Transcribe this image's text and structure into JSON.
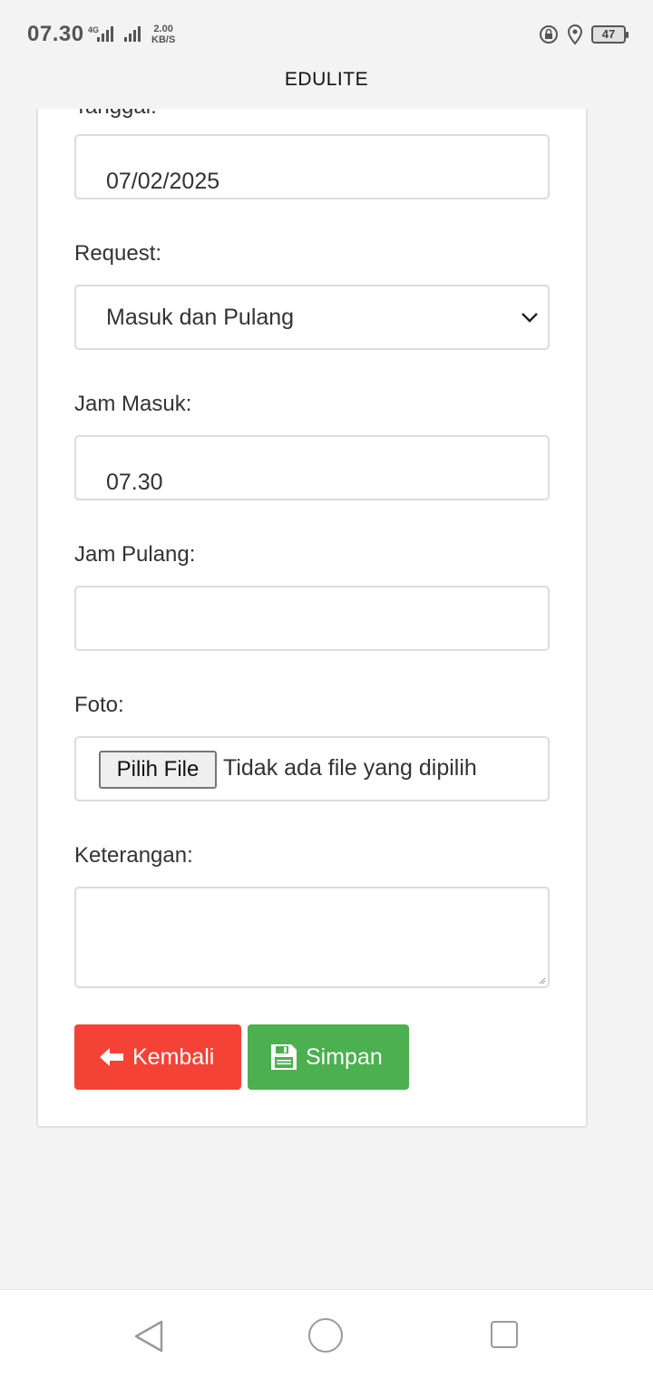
{
  "status_bar": {
    "time": "07.30",
    "network_type": "4G",
    "speed_value": "2.00",
    "speed_unit": "KB/S",
    "battery": "47",
    "icons": [
      "rotation-lock-icon",
      "location-icon",
      "battery-icon"
    ]
  },
  "app": {
    "title": "EDULITE"
  },
  "form": {
    "tanggal": {
      "label": "Tanggal:",
      "value": "07/02/2025"
    },
    "request": {
      "label": "Request:",
      "selected": "Masuk dan Pulang"
    },
    "jam_masuk": {
      "label": "Jam Masuk:",
      "value": "07.30"
    },
    "jam_pulang": {
      "label": "Jam Pulang:",
      "value": ""
    },
    "foto": {
      "label": "Foto:",
      "button": "Pilih File",
      "status": "Tidak ada file yang dipilih"
    },
    "keterangan": {
      "label": "Keterangan:",
      "value": ""
    }
  },
  "buttons": {
    "back": {
      "label": "Kembali",
      "color": "#f44336",
      "icon": "arrow-left-icon"
    },
    "save": {
      "label": "Simpan",
      "color": "#4caf50",
      "icon": "floppy-disk-icon"
    }
  },
  "nav": {
    "icons": [
      "back-triangle-icon",
      "home-circle-icon",
      "recents-square-icon"
    ]
  }
}
